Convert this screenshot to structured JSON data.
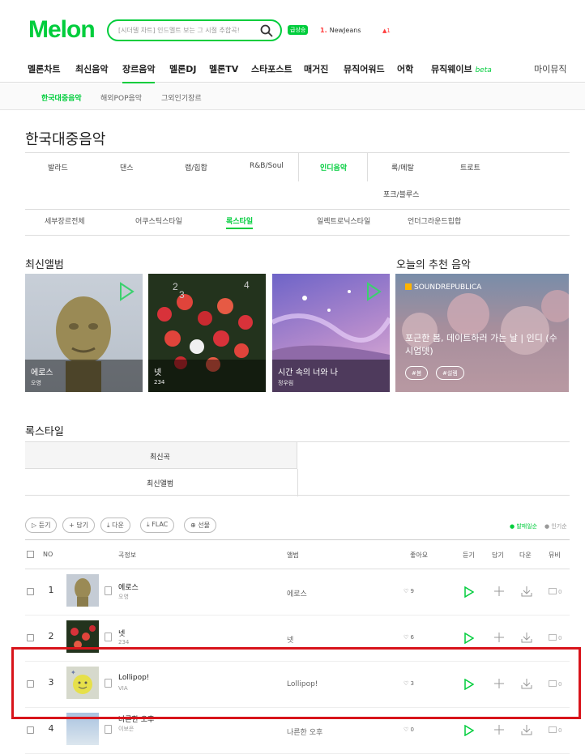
{
  "header": {
    "logo": "Melon",
    "search_placeholder": "[시더델 차트] 인드멜트 보는 그 시절 추합곡!",
    "rank_badge": "급상승",
    "rank_no": "1.",
    "rank_title": "NewJeans",
    "rank_change": "▲1"
  },
  "gnb": [
    "멜론차트",
    "최신음악",
    "장르음악",
    "멜론DJ",
    "멜론TV",
    "스타포스트",
    "매거진",
    "뮤직어워드",
    "어학",
    "뮤직웨이브"
  ],
  "gnb_beta": "beta",
  "gnb_my": "마이뮤직",
  "subnav": [
    "한국대중음악",
    "해외POP음악",
    "그외인기장르"
  ],
  "page_title": "한국대중음악",
  "genre_tabs": [
    "발라드",
    "댄스",
    "랩/힙합",
    "R&B/Soul",
    "인디음악",
    "록/메탈",
    "트로트",
    "포크/블루스"
  ],
  "style_tabs": [
    "세부장르전체",
    "어쿠스틱스타일",
    "록스타일",
    "일렉트로닉스타일",
    "언더그라운드힙합"
  ],
  "new_albums_title": "최신앨범",
  "recommend_title": "오늘의 추천 음악",
  "albums": [
    {
      "title": "에로스",
      "artist": "오영"
    },
    {
      "title": "넷",
      "artist": "234"
    },
    {
      "title": "시간 속의 너와 나",
      "artist": "정우림"
    }
  ],
  "recommend": {
    "brand": "SOUNDREPUBLICA",
    "text": "포근한 봄, 데이트하러 가는 날 | 인디 (수시업뎃)",
    "tags": [
      "#봄",
      "#설렘"
    ]
  },
  "section_title": "록스타일",
  "filter_tabs": [
    "최신곡",
    "최신앨범"
  ],
  "actions": [
    "듣기",
    "담기",
    "다운",
    "FLAC",
    "선물"
  ],
  "sort": [
    "발매일순",
    "인기순"
  ],
  "table_headers": [
    "NO",
    "곡정보",
    "앨범",
    "좋아요",
    "듣기",
    "담기",
    "다운",
    "뮤비"
  ],
  "songs": [
    {
      "no": "1",
      "title": "에로스",
      "artist": "오영",
      "album": "에로스",
      "likes": "9",
      "mv": "0"
    },
    {
      "no": "2",
      "title": "넷",
      "artist": "234",
      "album": "넷",
      "likes": "6",
      "mv": "0"
    },
    {
      "no": "3",
      "title": "Lollipop!",
      "artist": "VIA",
      "album": "Lollipop!",
      "likes": "3",
      "mv": "0"
    },
    {
      "no": "4",
      "title": "나른한 오후",
      "artist": "이보은",
      "album": "나른한 오후",
      "likes": "0",
      "mv": "0"
    }
  ],
  "colors": {
    "accent": "#00cd3c",
    "highlight": "#d8141b"
  }
}
